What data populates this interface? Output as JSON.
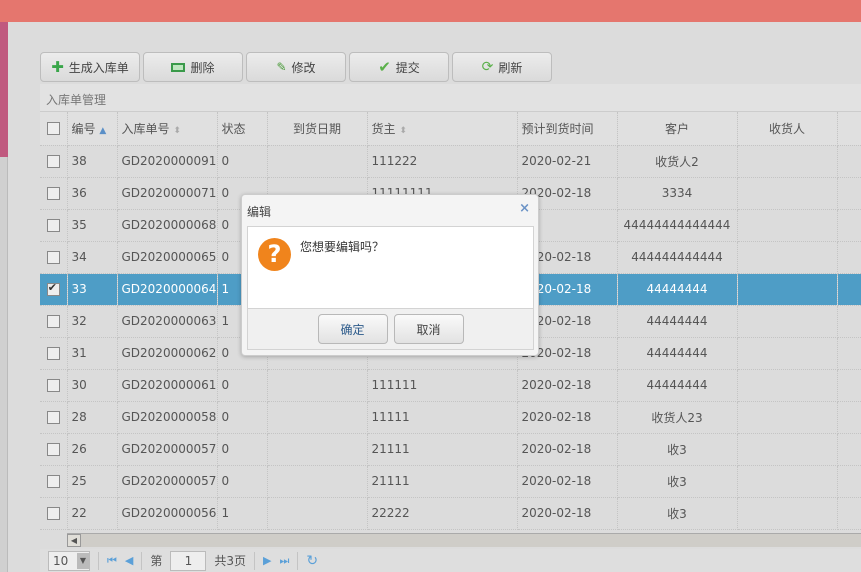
{
  "toolbar": {
    "create": "生成入库单",
    "delete": "删除",
    "edit": "修改",
    "submit": "提交",
    "refresh": "刷新"
  },
  "panel_title": "入库单管理",
  "columns": [
    "编号",
    "入库单号",
    "状态",
    "到货日期",
    "货主",
    "预计到货时间",
    "客户",
    "收货人"
  ],
  "rows": [
    [
      "38",
      "GD2020000091",
      "0",
      "",
      "111222",
      "2020-02-21",
      "收货人2",
      ""
    ],
    [
      "36",
      "GD2020000071",
      "0",
      "",
      "11111111",
      "2020-02-18",
      "3334",
      ""
    ],
    [
      "35",
      "GD2020000068",
      "0",
      "",
      "",
      "",
      "44444444444444",
      ""
    ],
    [
      "34",
      "GD2020000065",
      "0",
      "",
      "",
      "2020-02-18",
      "444444444444",
      ""
    ],
    [
      "33",
      "GD2020000064",
      "1",
      "",
      "",
      "2020-02-18",
      "44444444",
      ""
    ],
    [
      "32",
      "GD2020000063",
      "1",
      "",
      "",
      "2020-02-18",
      "44444444",
      ""
    ],
    [
      "31",
      "GD2020000062",
      "0",
      "",
      "",
      "2020-02-18",
      "44444444",
      ""
    ],
    [
      "30",
      "GD2020000061",
      "0",
      "",
      "111111",
      "2020-02-18",
      "44444444",
      ""
    ],
    [
      "28",
      "GD2020000058",
      "0",
      "",
      "11111",
      "2020-02-18",
      "收货人23",
      ""
    ],
    [
      "26",
      "GD2020000057",
      "0",
      "",
      "21111",
      "2020-02-18",
      "收3",
      ""
    ],
    [
      "25",
      "GD2020000057",
      "0",
      "",
      "21111",
      "2020-02-18",
      "收3",
      ""
    ],
    [
      "22",
      "GD2020000056",
      "1",
      "",
      "22222",
      "2020-02-18",
      "收3",
      ""
    ]
  ],
  "selected_row": "33",
  "pager": {
    "page_size": "10",
    "page_label": "第",
    "page": "1",
    "total": "共3页"
  },
  "dialog": {
    "title": "编辑",
    "message": "您想要编辑吗？",
    "ok": "确定",
    "cancel": "取消",
    "close": "×"
  }
}
